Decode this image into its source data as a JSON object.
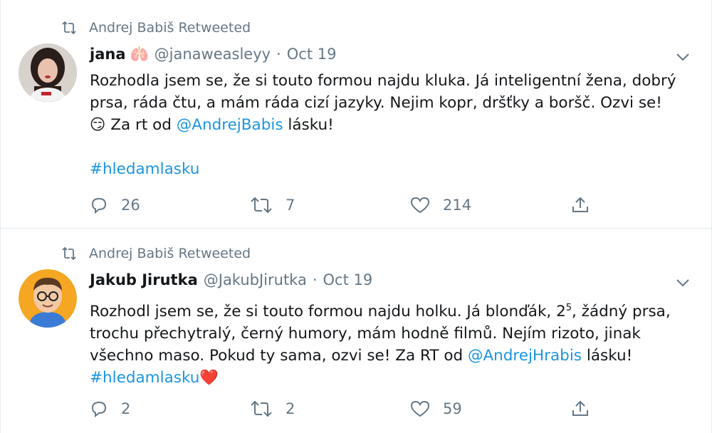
{
  "tweets": [
    {
      "retweeted_by": "Andrej Babiš Retweeted",
      "name": "jana",
      "name_emoji": "🫁",
      "handle": "@janaweasleyy",
      "separator": "·",
      "date": "Oct 19",
      "text": {
        "line1": "Rozhodla jsem se, že si touto formou najdu kluka. Já inteligentní žena, dobrý",
        "line2": "prsa, ráda čtu, a mám ráda cizí jazyky. Nejim kopr, dršťky a boršč. Ozvi se!",
        "line3_emoji": "😏",
        "line3_pre": " Za rt od ",
        "mention": "@AndrejBabis",
        "line3_post": " lásku!",
        "hashtag": "#hledamlasku"
      },
      "replies": "26",
      "retweets": "7",
      "likes": "214"
    },
    {
      "retweeted_by": "Andrej Babiš Retweeted",
      "name": "Jakub Jirutka",
      "handle": "@JakubJirutka",
      "separator": "·",
      "date": "Oct 19",
      "text": {
        "line1_pre": "Rozhodl jsem se, že si touto formou najdu holku. Já blonďák, 2",
        "line1_sup": "5",
        "line1_post": ", žádný prsa,",
        "line2": "trochu přechytralý, černý humory, mám hodně filmů. Nejím rizoto, jinak",
        "line3_pre": "všechno maso. Pokud ty sama, ozvi se! Za RT od ",
        "mention": "@AndrejHrabis",
        "line3_post": " lásku!",
        "hashtag": "#hledamlasku",
        "hashtag_emoji": "❤️"
      },
      "replies": "2",
      "retweets": "2",
      "likes": "59"
    }
  ],
  "colors": {
    "link": "#1b95e0",
    "muted": "#657786",
    "text": "#14171a",
    "heart": "#e0245e"
  }
}
